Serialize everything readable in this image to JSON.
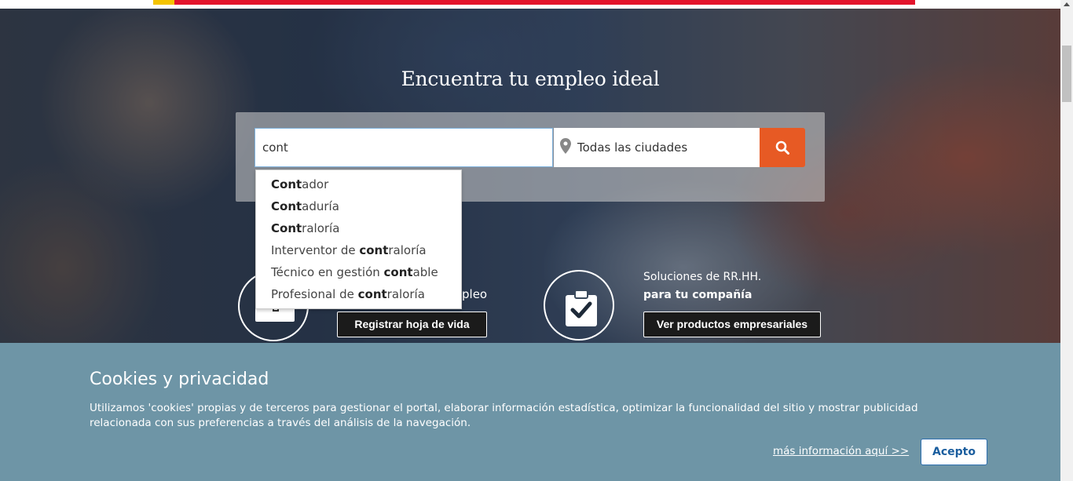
{
  "hero": {
    "title": "Encuentra tu empleo ideal"
  },
  "search": {
    "keyword_value": "cont",
    "city_value": "Todas las ciudades"
  },
  "suggestions": [
    {
      "match": "Cont",
      "prefix": "",
      "suffix": "ador"
    },
    {
      "match": "Cont",
      "prefix": "",
      "suffix": "aduría"
    },
    {
      "match": "Cont",
      "prefix": "",
      "suffix": "raloría"
    },
    {
      "match": "cont",
      "prefix": "Interventor de ",
      "suffix": "raloría"
    },
    {
      "match": "cont",
      "prefix": "Técnico en gestión ",
      "suffix": "able"
    },
    {
      "match": "cont",
      "prefix": "Profesional de ",
      "suffix": "raloría"
    }
  ],
  "cards": {
    "left": {
      "text_fragment": "pleo",
      "button": "Registrar hoja de vida"
    },
    "right": {
      "title": "Soluciones de RR.HH.",
      "subtitle": "para tu compañía",
      "button": "Ver productos empresariales"
    }
  },
  "cookies": {
    "title": "Cookies y privacidad",
    "text": "Utilizamos 'cookies' propias y de terceros para gestionar el portal, elaborar información estadística, optimizar la funcionalidad del sitio y mostrar publicidad relacionada con sus preferencias a través del análisis de la navegación.",
    "more_link": "más información aquí >>",
    "accept": "Acepto"
  },
  "icons": {
    "search": "search-icon",
    "city": "map-pin-icon",
    "left_card": "device-icon",
    "right_card": "clipboard-check-icon"
  },
  "colors": {
    "brand_red": "#e3142c",
    "search_button": "#e75a24",
    "cookie_banner": "#6e95a6",
    "accept_text": "#1a5d9e"
  }
}
